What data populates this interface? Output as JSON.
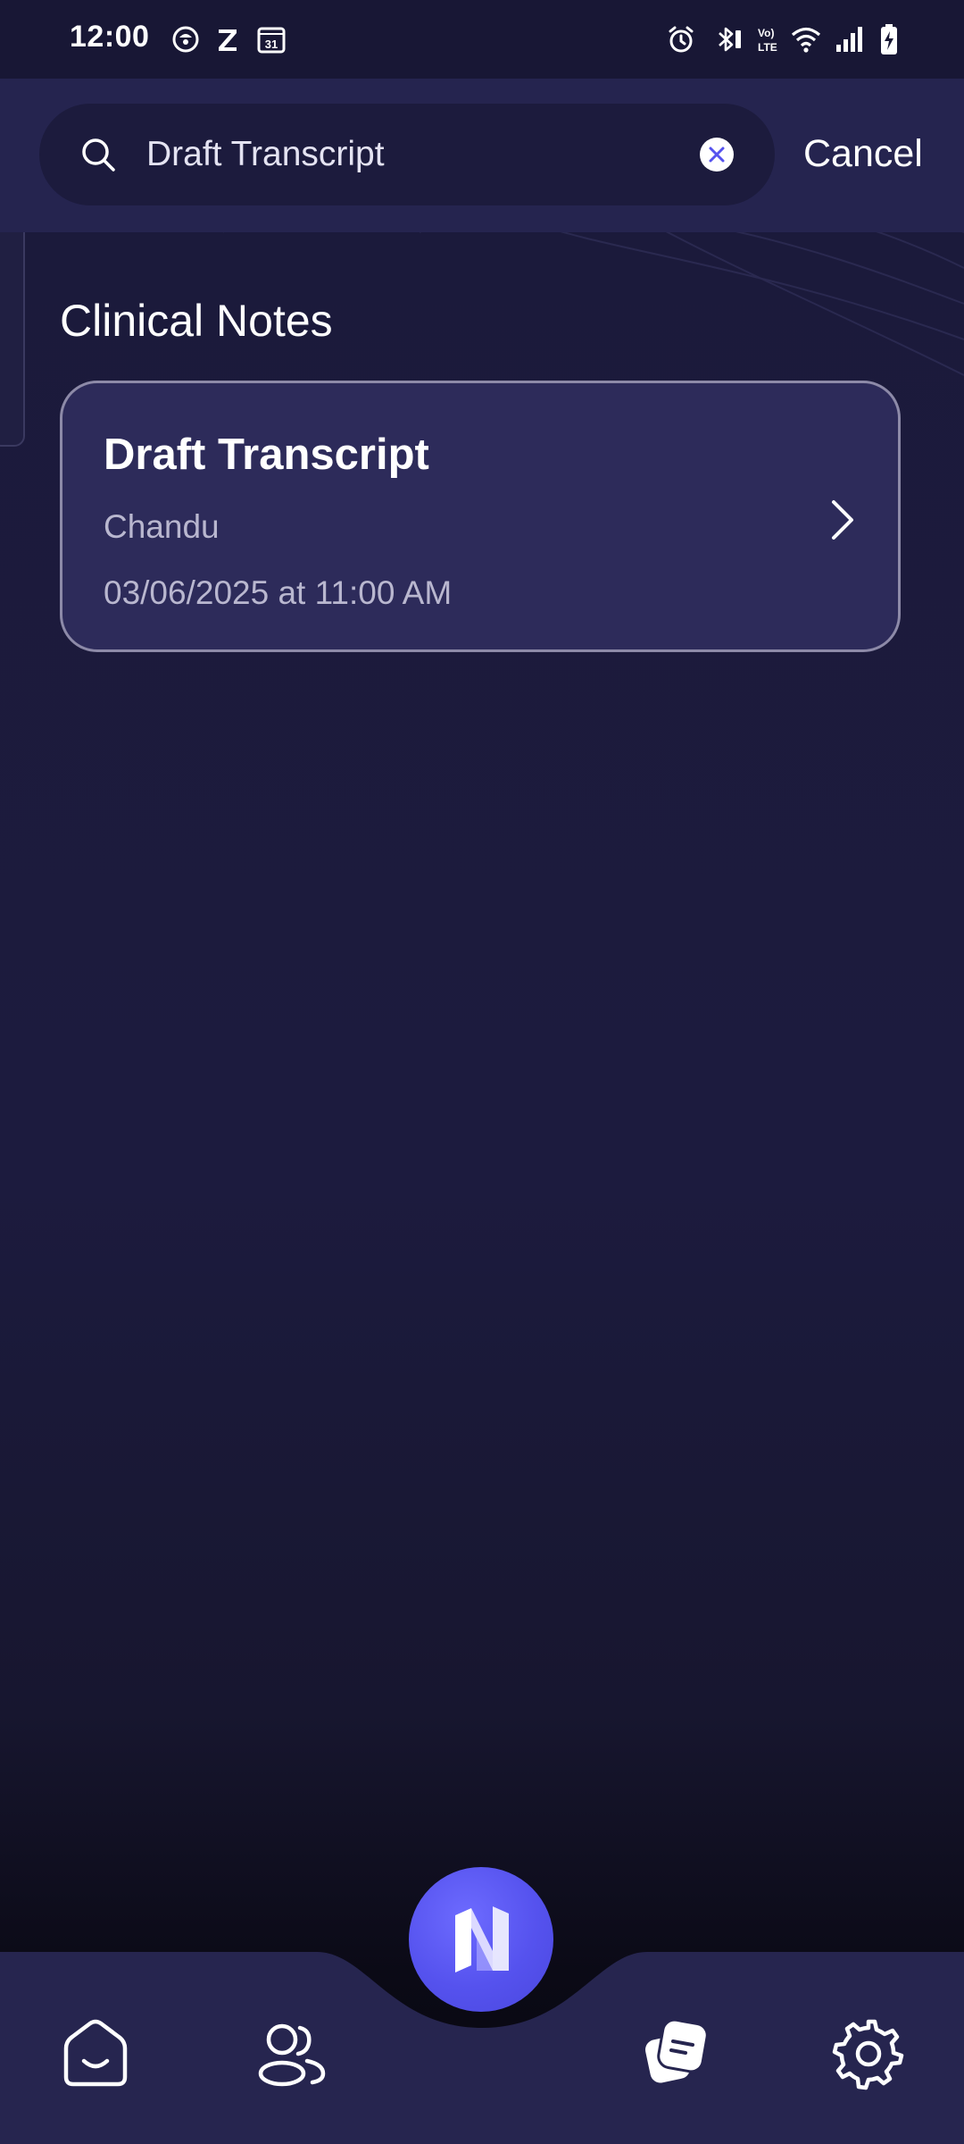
{
  "status_bar": {
    "time": "12:00",
    "calendar_day": "31",
    "left_icons": [
      "chat-app-icon",
      "z-app-icon",
      "calendar-icon"
    ],
    "right_icons": [
      "alarm-icon",
      "bluetooth-icon",
      "volte-icon",
      "wifi-icon",
      "signal-icon",
      "battery-charging-icon"
    ]
  },
  "search": {
    "value": "Draft Transcript",
    "cancel_label": "Cancel"
  },
  "section": {
    "title": "Clinical Notes"
  },
  "notes": [
    {
      "title": "Draft Transcript",
      "patient": "Chandu",
      "datetime": "03/06/2025 at 11:00 AM"
    }
  ],
  "bottom_nav": {
    "items": [
      "home-icon",
      "patients-icon",
      "notes-icon",
      "settings-icon"
    ],
    "active": "notes-icon",
    "center_action": "new-recording-logo"
  },
  "colors": {
    "background": "#1b1a3a",
    "header": "#25244f",
    "card": "#2d2b5a",
    "accent": "#5552ee"
  }
}
